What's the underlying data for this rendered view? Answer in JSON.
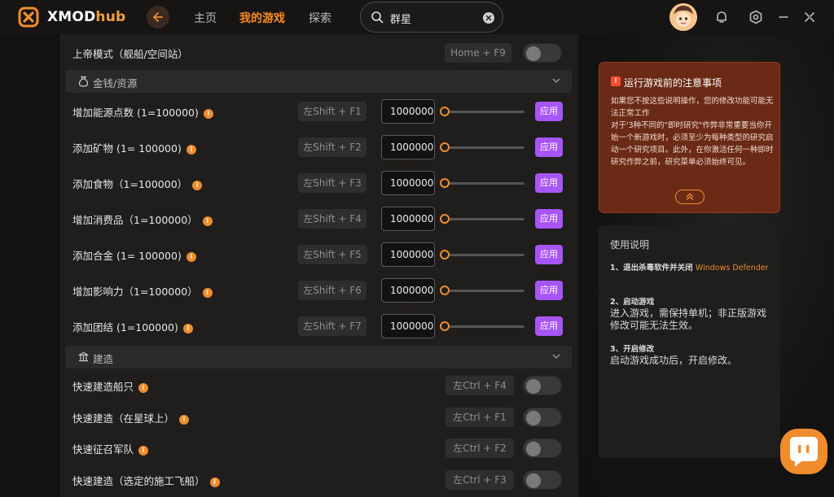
{
  "app": {
    "brand_main": "XMOD",
    "brand_sub": "hub"
  },
  "nav": {
    "home": "主页",
    "my_games": "我的游戏",
    "explore": "探索"
  },
  "search": {
    "value": "群星",
    "placeholder": ""
  },
  "god_mode": {
    "label": "上帝模式（舰船/空间站）",
    "hotkey": "Home + F9",
    "enabled": false
  },
  "sections": {
    "money": "金钱/资源",
    "build": "建造"
  },
  "resource_rows": [
    {
      "label": "增加能源点数 (1=100000)",
      "hotkey": "左Shift + F1",
      "value": "1000000",
      "slider": 0,
      "apply": "应用"
    },
    {
      "label": "添加矿物 (1= 100000)",
      "hotkey": "左Shift + F2",
      "value": "1000000",
      "slider": 0,
      "apply": "应用"
    },
    {
      "label": "添加食物（1=100000）",
      "hotkey": "左Shift + F3",
      "value": "1000000",
      "slider": 0,
      "apply": "应用"
    },
    {
      "label": "增加消费品（1=100000）",
      "hotkey": "左Shift + F4",
      "value": "1000000",
      "slider": 0,
      "apply": "应用"
    },
    {
      "label": "添加合金 (1= 100000)",
      "hotkey": "左Shift + F5",
      "value": "1000000",
      "slider": 0,
      "apply": "应用"
    },
    {
      "label": "增加影响力（1=100000）",
      "hotkey": "左Shift + F6",
      "value": "1000000",
      "slider": 0,
      "apply": "应用"
    },
    {
      "label": "添加团结 (1=100000)",
      "hotkey": "左Shift + F7",
      "value": "1000000",
      "slider": 0,
      "apply": "应用"
    }
  ],
  "build_rows": [
    {
      "label": "快速建造船只",
      "hotkey": "左Ctrl + F4",
      "enabled": false
    },
    {
      "label": "快速建造（在星球上）",
      "hotkey": "左Ctrl + F1",
      "enabled": false
    },
    {
      "label": "快速征召军队",
      "hotkey": "左Ctrl + F2",
      "enabled": false
    },
    {
      "label": "快速建造（选定的施工飞船）",
      "hotkey": "左Ctrl + F3",
      "enabled": false
    }
  ],
  "notice": {
    "title": "运行游戏前的注意事项",
    "icon": "!",
    "body": "如果您不按这些说明操作，您的修改功能可能无法正常工作\n对于'3种不同的\"即时研究\"作弊非常重要当你开始一个新游戏时，必须至少为每种类型的研究启动一个研究项目。此外，在你激活任何一种即时研究作弊之前，研究菜单必须始终可见。"
  },
  "guide": {
    "title": "使用说明",
    "step1_head": "1、退出杀毒软件并关闭 ",
    "step1_highlight": "Windows Defender",
    "step2_head": "2、启动游戏",
    "step2_body": "进入游戏，需保持单机；非正版游戏修改可能无法生效。",
    "step3_head": "3、开启修改",
    "step3_body": "启动游戏成功后，开启修改。"
  },
  "colors": {
    "accent": "#f08c2c",
    "apply": "#a855f7",
    "notice_bg": "#6b2a15"
  }
}
